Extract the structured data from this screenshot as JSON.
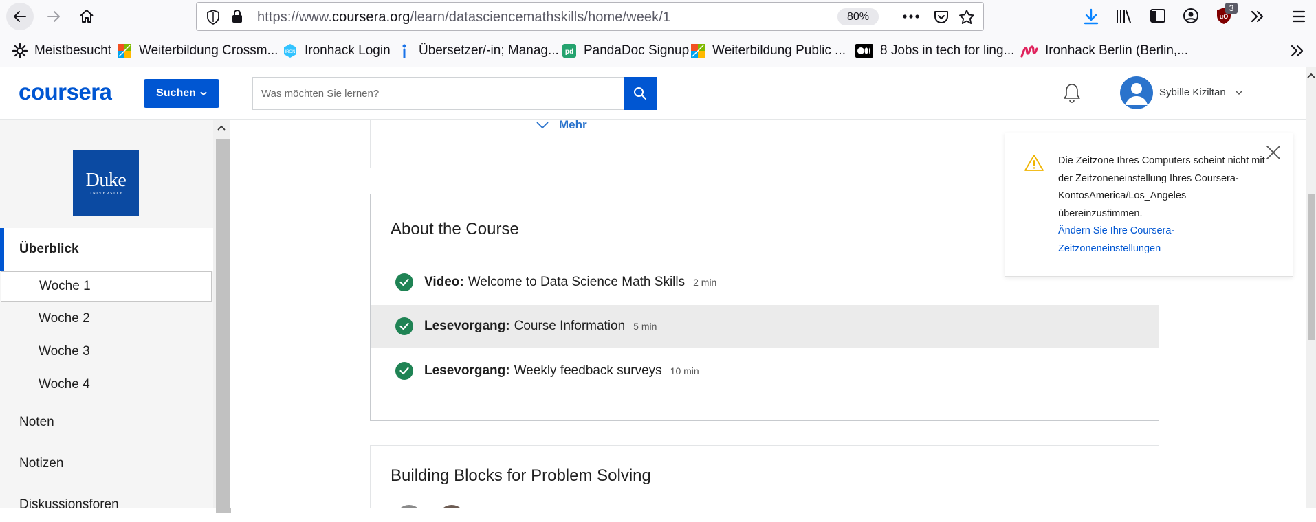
{
  "browser": {
    "url_prefix": "https://www.",
    "url_domain": "coursera.org",
    "url_path": "/learn/datasciencemathskills/home/week/1",
    "zoom": "80%",
    "extension_badge": "3"
  },
  "bookmarks": [
    {
      "label": "Meistbesucht",
      "icon": "gear-icon"
    },
    {
      "label": "Weiterbildung Crossm...",
      "icon": "multicolor-grid-icon"
    },
    {
      "label": "Ironhack Login",
      "icon": "ironhack-icon"
    },
    {
      "label": "Übersetzer/-in; Manag...",
      "icon": "info-icon"
    },
    {
      "label": "PandaDoc Signup",
      "icon": "pandadoc-icon"
    },
    {
      "label": "Weiterbildung Public ...",
      "icon": "multicolor-grid-icon"
    },
    {
      "label": "8 Jobs in tech for ling...",
      "icon": "medium-icon"
    },
    {
      "label": "Ironhack Berlin (Berlin,...",
      "icon": "ironhack-m-icon"
    }
  ],
  "header": {
    "logo": "coursera",
    "search_button": "Suchen",
    "search_placeholder": "Was möchten Sie lernen?",
    "user_name": "Sybille Kiziltan"
  },
  "sidebar": {
    "university_logo_line1": "Duke",
    "university_logo_line2": "UNIVERSITY",
    "items": [
      {
        "label": "Überblick",
        "active": true
      },
      {
        "label": "Woche 1",
        "selected": true
      },
      {
        "label": "Woche 2"
      },
      {
        "label": "Woche 3"
      },
      {
        "label": "Woche 4"
      },
      {
        "label": "Noten"
      },
      {
        "label": "Notizen"
      },
      {
        "label": "Diskussionsforen"
      }
    ]
  },
  "main": {
    "more_label": "Mehr",
    "about": {
      "title": "About the Course",
      "lessons": [
        {
          "type": "Video:",
          "title": "Welcome to Data Science Math Skills",
          "duration": "2 min"
        },
        {
          "type": "Lesevorgang:",
          "title": "Course Information",
          "duration": "5 min"
        },
        {
          "type": "Lesevorgang:",
          "title": "Weekly feedback surveys",
          "duration": "10 min"
        }
      ]
    },
    "building_title": "Building Blocks for Problem Solving"
  },
  "toast": {
    "message": "Die Zeitzone Ihres Computers scheint nicht mit der Zeitzoneneinstellung Ihres Coursera-KontosAmerica/Los_Angeles übereinzustimmen.",
    "link": "Ändern Sie Ihre Coursera-Zeitzoneneinstellungen"
  },
  "colors": {
    "brand": "#0056d2",
    "check": "#1f8354",
    "warning": "#f0b400"
  }
}
